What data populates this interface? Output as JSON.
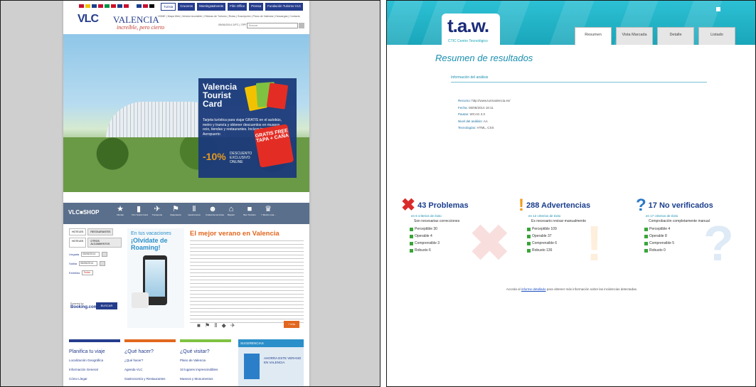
{
  "left": {
    "flags": [
      "#c8102e",
      "#f2c200",
      "#1a3e8c",
      "#c8102e",
      "#009246",
      "#ce1126",
      "#1a3e8c",
      "#c8102e",
      "#ffffff",
      "#1a3e8c",
      "#c8102e",
      "#000000"
    ],
    "topnav": [
      "Turista",
      "Cruceros",
      "Meetings&Events",
      "Film Office",
      "Prensa",
      "Fundación Turismo VLC"
    ],
    "logo_a": "VLC",
    "logo_b": "VALENCIA",
    "tagline": "increíble, pero cierto",
    "quicklinks": "HOME | Mapa Web | Versión Accesible | Oficinas de Turismo | Rutas | Suscripción | Plano de Valencia | Descargas | Contacto",
    "date": "05/06/2014",
    "weather": "24ºC | 75ºF",
    "search_placeholder": "Buscar",
    "hero": {
      "card_title": "Valencia Tourist Card",
      "card_text": "Tarjeta turística para viajar GRATIS en el autobús, metro y tranvía y obtener descuentos en museos, ocio, tiendas y restaurantes. Incluye trayecto al Aeropuerto",
      "pct": "-10%",
      "desc": "DESCUENTO EXCLUSIVO ONLINE",
      "gratis": "GRATIS FREE TAPA + CAÑA"
    },
    "shop": {
      "logo": "VLC■SHOP",
      "items": [
        {
          "icon": "★",
          "label": "Ofertas"
        },
        {
          "icon": "▮",
          "label": "VLC Tourist Card"
        },
        {
          "icon": "✈",
          "label": "Transporte"
        },
        {
          "icon": "⚑",
          "label": "Alojamiento"
        },
        {
          "icon": "Ⅱ",
          "label": "Gastronomía"
        },
        {
          "icon": "☻",
          "label": "Ciudad de las Artes"
        },
        {
          "icon": "⌂",
          "label": "Bioparc"
        },
        {
          "icon": "■",
          "label": "Bus Turístico"
        },
        {
          "icon": "♛",
          "label": "Y Mucho más..."
        }
      ]
    },
    "booking": {
      "tabs": [
        "HOTELES",
        "RESTAURANTES"
      ],
      "tabs2": [
        "HOTELES",
        "OTROS ALOJAMIENTOS"
      ],
      "arrival_label": "Llegada",
      "arrival": "05/06/2014",
      "departure_label": "Salida",
      "departure": "06/06/2014",
      "stars_label": "Estrellas",
      "stars": "Todas",
      "powered": "Powered by",
      "brand": "Booking.com",
      "button": "BUSCAR"
    },
    "roaming": {
      "line1": "En tus vacaciones",
      "line2": "¡Olvídate de Roaming!"
    },
    "article": {
      "title": "El mejor verano en Valencia",
      "more": "+ info"
    },
    "columns": [
      {
        "color": "#243c8c",
        "title": "Planifica tu viaje",
        "links": [
          "Localización Geográfica",
          "Información General",
          "Cómo Llegar"
        ]
      },
      {
        "color": "#e2671f",
        "title": "¿Qué hacer?",
        "links": [
          "¿Qué hacer?",
          "Agenda VLC",
          "Gastronomía y Restaurantes"
        ]
      },
      {
        "color": "#7fc241",
        "title": "¿Qué visitar?",
        "links": [
          "Plano de Valencia",
          "10 lugares imprescindibles",
          "Museos y Monumentos"
        ]
      }
    ],
    "suggestions": {
      "title": "SUGERENCIAS",
      "text": "AHORRA ESTE VERANO EN VALENCIA"
    }
  },
  "right": {
    "logo": "t.a.w.",
    "logo_sub": "CTIC Centro Tecnológico",
    "tabs": [
      "Resumen",
      "Vista Marcada",
      "Detalle",
      "Listado"
    ],
    "title": "Resumen de resultados",
    "section": "Información del análisis",
    "info": [
      {
        "k": "Recurso:",
        "v": "http://www.turisvalencia.es/"
      },
      {
        "k": "Fecha:",
        "v": "05/06/2014 18:11"
      },
      {
        "k": "Pautas:",
        "v": "WCAG 2.0"
      },
      {
        "k": "Nivel del análisis:",
        "v": "AA"
      },
      {
        "k": "Tecnologías:",
        "v": "HTML, CSS"
      }
    ],
    "summary": [
      {
        "mark": "✖",
        "color": "#d92b2b",
        "count": "43 Problemas",
        "crit": "en 6 criterios de éxito",
        "desc": "Son necesarias correcciones",
        "items": [
          "Perceptible 30",
          "Operable 4",
          "Comprensible 3",
          "Robusto 6"
        ]
      },
      {
        "mark": "!",
        "color": "#f29b1d",
        "count": "288 Advertencias",
        "crit": "en 12 criterios de éxito",
        "desc": "Es necesario revisar manualmente",
        "items": [
          "Perceptible 109",
          "Operable 37",
          "Comprensible 6",
          "Robusto 136"
        ]
      },
      {
        "mark": "?",
        "color": "#2a78c7",
        "count": "17 No verificados",
        "crit": "en 17 criterios de éxito",
        "desc": "Comprobación completamente manual",
        "items": [
          "Perceptible 4",
          "Operable 8",
          "Comprensible 5",
          "Robusto 0"
        ]
      }
    ],
    "footer_pre": "Acceda al",
    "footer_link": "informe detallado",
    "footer_post": "para obtener más información sobre las incidencias detectadas."
  }
}
